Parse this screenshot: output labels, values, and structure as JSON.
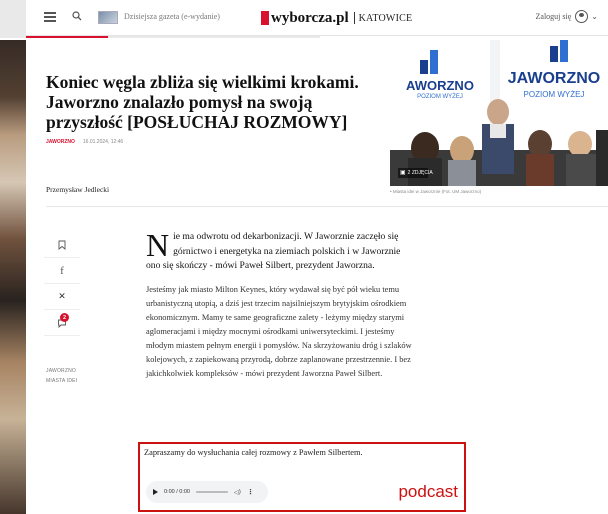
{
  "header": {
    "edition_label": "Dzisiejsza gazeta (e-wydanie)",
    "brand": "wyborcza.pl",
    "city": "KATOWICE",
    "login_label": "Zaloguj się",
    "chevron": "⌄",
    "colors": {
      "accent": "#d9112f"
    }
  },
  "article": {
    "title": "Koniec węgla zbliża się wielkimi krokami. Jaworzno znalazło pomysł na swoją przyszłość [POSŁUCHAJ ROZMOWY]",
    "section_tag": "JAWORZNO",
    "date": "16.01.2024, 12:46",
    "author": "Przemysław Jedlecki",
    "dropcap": "N",
    "lead": "ie ma odwrotu od dekarbonizacji. W Jaworznie zaczęło się górnictwo i energetyka na ziemiach polskich i w Jaworznie ono się skończy - mówi Paweł Silbert, prezydent Jaworzna.",
    "paragraph": "Jesteśmy jak miasto Milton Keynes, który wydawał się być pół wieku temu urbanistyczną utopią, a dziś jest trzecim najsilniejszym brytyjskim ośrodkiem ekonomicznym. Mamy te same geograficzne zalety - leżymy między starymi aglomeracjami i między mocnymi ośrodkami uniwersyteckimi. I jesteśmy młodym miastem pełnym energii i pomysłów. Na skrzyżowaniu dróg i szlaków kolejowych, z zapiekowaną przyrodą, dobrze zaplanowane przestrzennie. I bez jakichkolwiek kompleksów - mówi prezydent Jaworzna Paweł Silbert."
  },
  "hero": {
    "banner_left": "AWORZNO",
    "banner_left_sub": "POZIOM WYŻEJ",
    "banner_right": "JAWORZNO",
    "banner_right_sub": "POZIOM WYŻEJ",
    "gallery_label": "2 ZDJĘCIA",
    "caption": "• Miasta idei w Jaworznie (Fot. UM Jaworzno)"
  },
  "rail": {
    "items": [
      {
        "icon": "bookmark-icon",
        "glyph": "☐"
      },
      {
        "icon": "facebook-icon",
        "glyph": "f"
      },
      {
        "icon": "x-icon",
        "glyph": "𝕏"
      },
      {
        "icon": "comment-icon",
        "glyph": "○"
      }
    ],
    "comment_count": "2",
    "tags": [
      "JAWORZNO",
      "MIASTA IDEI"
    ]
  },
  "podcast": {
    "intro": "Zapraszamy do wysłuchania całej rozmowy z Pawłem Silbertem.",
    "time": "0:00 / 0:00",
    "label": "podcast"
  }
}
